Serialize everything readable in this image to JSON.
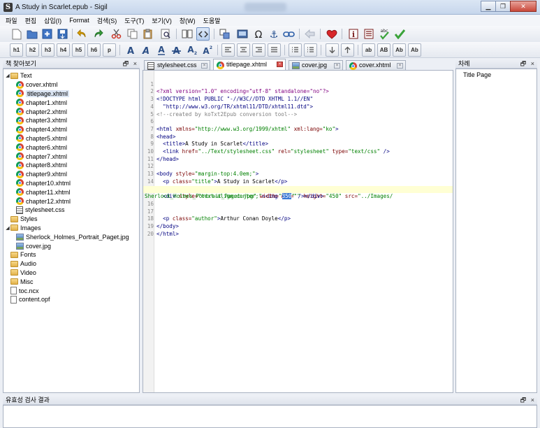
{
  "window": {
    "title": "A Study in Scarlet.epub - Sigil"
  },
  "menu": [
    "파일",
    "편집",
    "삽입(I)",
    "Format",
    "검색(S)",
    "도구(T)",
    "보기(V)",
    "창(W)",
    "도움말"
  ],
  "format_toolbar": {
    "headings": [
      "h1",
      "h2",
      "h3",
      "h4",
      "h5",
      "h6",
      "p"
    ],
    "case_buttons": [
      "ab",
      "AB",
      "Ab",
      "Ab"
    ],
    "spellcheck_label": "abc"
  },
  "book_browser": {
    "title": "책 찾아보기",
    "controls": [
      "🗗",
      "×"
    ],
    "folders": {
      "text": "Text",
      "styles": "Styles",
      "images": "Images",
      "fonts": "Fonts",
      "audio": "Audio",
      "video": "Video",
      "misc": "Misc"
    },
    "text_files": [
      "cover.xhtml",
      "titlepage.xhtml",
      "chapter1.xhtml",
      "chapter2.xhtml",
      "chapter3.xhtml",
      "chapter4.xhtml",
      "chapter5.xhtml",
      "chapter6.xhtml",
      "chapter7.xhtml",
      "chapter8.xhtml",
      "chapter9.xhtml",
      "chapter10.xhtml",
      "chapter11.xhtml",
      "chapter12.xhtml"
    ],
    "style_file": "stylesheet.css",
    "image_files": [
      "Sherlock_Holmes_Portrait_Paget.jpg",
      "cover.jpg"
    ],
    "root_files": [
      "toc.ncx",
      "content.opf"
    ],
    "selected": "titlepage.xhtml"
  },
  "tabs": [
    {
      "label": "stylesheet.css",
      "icon": "css-icon"
    },
    {
      "label": "titlepage.xhtml",
      "icon": "chrome-icon",
      "active": true
    },
    {
      "label": "cover.jpg",
      "icon": "image-icon"
    },
    {
      "label": "cover.xhtml",
      "icon": "chrome-icon"
    }
  ],
  "editor": {
    "lines": {
      "l1": {
        "n": "1",
        "a": "<?xml version=\"1.0\" encoding=\"utf-8\" standalone=\"no\"?>"
      },
      "l2": {
        "n": "2",
        "a": "<!DOCTYPE html PUBLIC \"-//W3C//DTD XHTML 1.1//EN\""
      },
      "l3": {
        "n": "3",
        "a": "  \"http://www.w3.org/TR/xhtml11/DTD/xhtml11.dtd\">"
      },
      "l4": {
        "n": "4",
        "a": "<!--created by koTxt2Epub conversion tool-->"
      },
      "l5": {
        "n": "5"
      },
      "l6": {
        "n": "6",
        "a": "<html ",
        "b": "xmlns=",
        "c": "\"http://www.w3.org/1999/xhtml\"",
        "d": " xml:lang=",
        "e": "\"ko\"",
        "f": ">"
      },
      "l7": {
        "n": "7",
        "a": "<head>"
      },
      "l8": {
        "n": "8",
        "a": "  <title>",
        "b": "A Study in Scarlet",
        "c": "</title>"
      },
      "l9": {
        "n": "9",
        "a": "  <link ",
        "b": "href=",
        "c": "\"../Text/stylesheet.css\"",
        "d": " rel=",
        "e": "\"stylesheet\"",
        "f": " type=",
        "g": "\"text/css\"",
        "h": " />"
      },
      "l10": {
        "n": "10",
        "a": "</head>"
      },
      "l11": {
        "n": "11"
      },
      "l12": {
        "n": "12",
        "a": "<body ",
        "b": "style=",
        "c": "\"margin-top:4.0em;\"",
        "d": ">"
      },
      "l13": {
        "n": "13",
        "a": "  <p ",
        "b": "class=",
        "c": "\"title\"",
        "d": ">",
        "e": "A Study in Scarlet",
        "f": "</p>"
      },
      "l14": {
        "n": "14"
      },
      "l15": {
        "n": "15",
        "a": "  <div ",
        "b": "style=",
        "c": "\"text-align:center;\"",
        "d": "><img ",
        "e": "alt=",
        "f": "\"\"",
        "g": " height=",
        "h": "\"450\"",
        "i": " src=",
        "j": "\"../Images/"
      },
      "l15b": {
        "a": "Sherlock_Holmes_Portrait_Paget.jpg\"",
        "b": " width=",
        "c": "\"",
        "d": "350",
        "e": "\"",
        "f": " /></div>"
      },
      "l16": {
        "n": "16"
      },
      "l17": {
        "n": "17",
        "a": "  <p ",
        "b": "class=",
        "c": "\"author\"",
        "d": ">",
        "e": "Arthur Conan Doyle",
        "f": "</p>"
      },
      "l18": {
        "n": "18",
        "a": "</body>"
      },
      "l19": {
        "n": "19",
        "a": "</html>"
      },
      "l20": {
        "n": "20"
      }
    }
  },
  "toc": {
    "title": "차례",
    "controls": [
      "🗗",
      "×"
    ],
    "items": [
      "Title Page"
    ]
  },
  "validation": {
    "title": "유효성 검사 결과",
    "controls": [
      "🗗",
      "×"
    ]
  }
}
